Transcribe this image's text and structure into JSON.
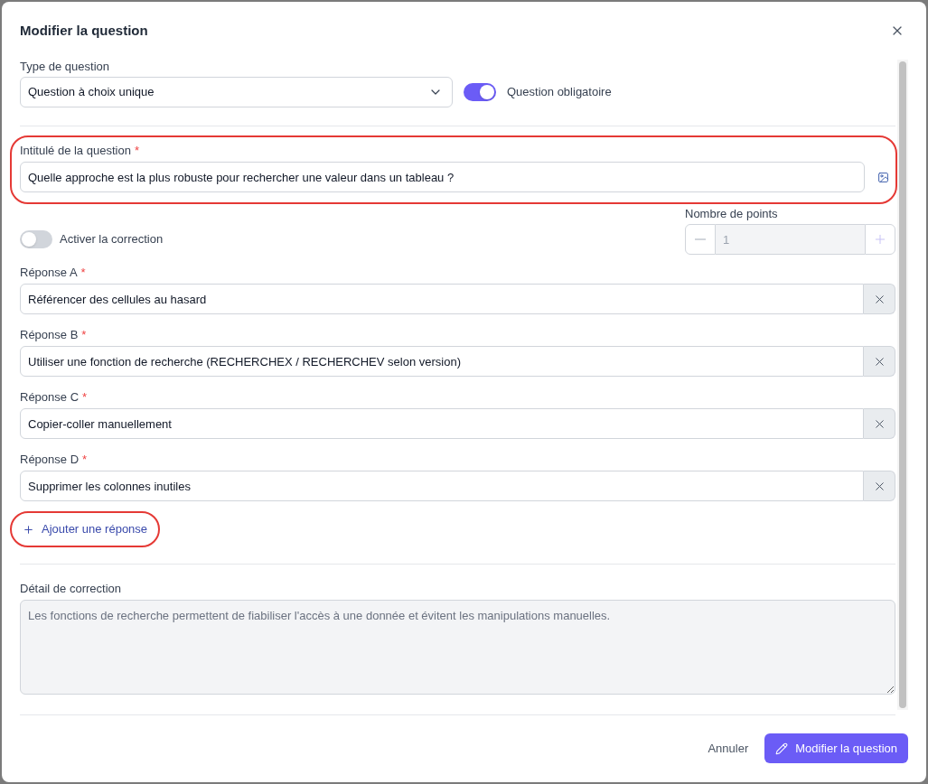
{
  "dialog": {
    "title": "Modifier la question"
  },
  "question_type": {
    "label": "Type de question",
    "value": "Question à choix unique"
  },
  "required_toggle": {
    "label": "Question obligatoire",
    "on": true
  },
  "question_text": {
    "label": "Intitulé de la question",
    "required_mark": "*",
    "value": "Quelle approche est la plus robuste pour rechercher une valeur dans un tableau ?",
    "highlighted": true
  },
  "correction_toggle": {
    "label": "Activer la correction",
    "on": false
  },
  "points": {
    "label": "Nombre de points",
    "value": "1",
    "disabled": true
  },
  "answers": [
    {
      "label": "Réponse A",
      "required_mark": "*",
      "value": "Référencer des cellules au hasard"
    },
    {
      "label": "Réponse B",
      "required_mark": "*",
      "value": "Utiliser une fonction de recherche (RECHERCHEX / RECHERCHEV selon version)"
    },
    {
      "label": "Réponse C",
      "required_mark": "*",
      "value": "Copier-coller manuellement"
    },
    {
      "label": "Réponse D",
      "required_mark": "*",
      "value": "Supprimer les colonnes inutiles"
    }
  ],
  "add_answer": {
    "label": "Ajouter une réponse",
    "highlighted": true
  },
  "correction_detail": {
    "label": "Détail de correction",
    "value": "Les fonctions de recherche permettent de fiabiliser l'accès à une donnée et évitent les manipulations manuelles.",
    "disabled": true
  },
  "footer": {
    "cancel": "Annuler",
    "submit": "Modifier la question"
  }
}
